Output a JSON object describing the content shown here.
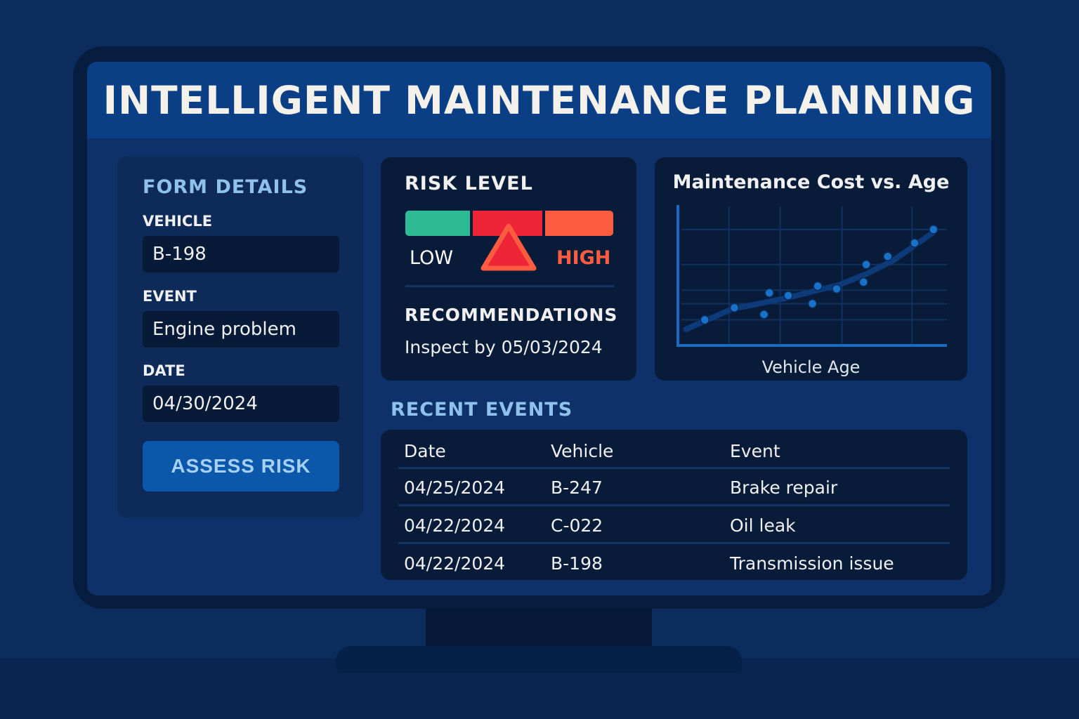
{
  "header": {
    "title": "INTELLIGENT MAINTENANCE PLANNING"
  },
  "form": {
    "title": "FORM DETAILS",
    "vehicle_label": "VEHICLE",
    "vehicle_value": "B-198",
    "event_label": "EVENT",
    "event_value": "Engine problem",
    "date_label": "DATE",
    "date_value": "04/30/2024",
    "assess_button": "ASSESS RISK"
  },
  "risk": {
    "title": "RISK LEVEL",
    "low_label": "LOW",
    "high_label": "HIGH",
    "level": "medium-high",
    "colors": {
      "low": "#2dbb94",
      "mid": "#ee2537",
      "high": "#fb5c40"
    },
    "recommendations_title": "RECOMMENDATIONS",
    "recommendation": "Inspect by 05/03/2024"
  },
  "chart_data": {
    "type": "scatter",
    "title": "Maintenance Cost vs. Age",
    "xlabel": "Vehicle Age",
    "ylabel": "",
    "xlim": [
      0,
      10
    ],
    "ylim": [
      0,
      10
    ],
    "grid": true,
    "x": [
      1.0,
      2.1,
      3.2,
      3.4,
      4.1,
      5.0,
      5.2,
      5.9,
      6.9,
      7.0,
      7.8,
      8.8,
      9.5
    ],
    "y": [
      1.9,
      2.8,
      2.3,
      3.9,
      3.7,
      3.1,
      4.4,
      4.2,
      4.7,
      6.0,
      6.6,
      7.6,
      8.6
    ],
    "trend": [
      [
        0.3,
        1.2
      ],
      [
        2,
        2.7
      ],
      [
        4,
        3.5
      ],
      [
        6,
        4.5
      ],
      [
        7,
        5.3
      ],
      [
        8,
        6.3
      ],
      [
        9.5,
        8.4
      ]
    ]
  },
  "events": {
    "title": "RECENT EVENTS",
    "columns": [
      "Date",
      "Vehicle",
      "Event"
    ],
    "rows": [
      [
        "04/25/2024",
        "B-247",
        "Brake repair"
      ],
      [
        "04/22/2024",
        "C-022",
        "Oil leak"
      ],
      [
        "04/22/2024",
        "B-198",
        "Transmission issue"
      ]
    ]
  }
}
